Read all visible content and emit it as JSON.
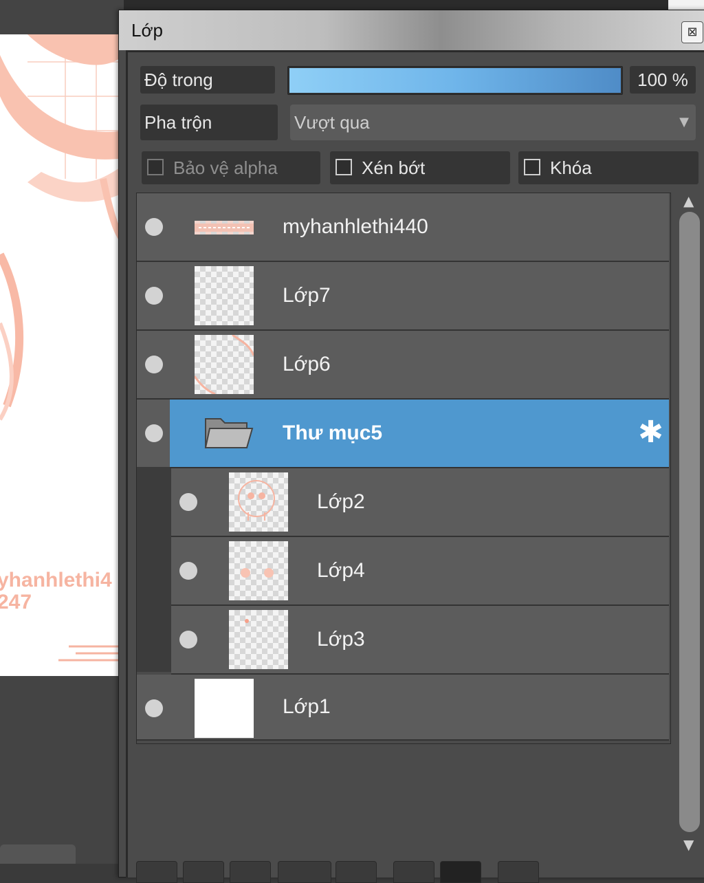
{
  "canvas": {
    "watermark_line1": "yhanhlethi4",
    "watermark_line2": "247",
    "accent_color": "#f6b4a1"
  },
  "window": {
    "title": "Lớp",
    "close_icon": "close-icon"
  },
  "controls": {
    "opacity_label": "Độ trong",
    "opacity_value": "100 %",
    "opacity_fraction": 1.0,
    "blend_label": "Pha trộn",
    "blend_value": "Vượt qua",
    "protect_alpha_label": "Bảo vệ alpha",
    "clip_label": "Xén bớt",
    "lock_label": "Khóa"
  },
  "layers": [
    {
      "name": "myhanhlethi440",
      "thumb": "text-strip"
    },
    {
      "name": "Lớp7",
      "thumb": "transparent"
    },
    {
      "name": "Lớp6",
      "thumb": "transparent-lines"
    },
    {
      "name": "Thư mục5",
      "thumb": "folder-icon",
      "selected": true,
      "settings_icon": "gear-icon"
    },
    {
      "name": "Lớp2",
      "thumb": "face-sketch",
      "in_folder": true
    },
    {
      "name": "Lớp4",
      "thumb": "eyes",
      "in_folder": true
    },
    {
      "name": "Lớp3",
      "thumb": "dot",
      "in_folder": true
    },
    {
      "name": "Lớp1",
      "thumb": "white"
    }
  ],
  "colors": {
    "selected_row": "#4f98cf",
    "row": "#5c5c5c",
    "opacity_bar": "#6fb5ea"
  }
}
